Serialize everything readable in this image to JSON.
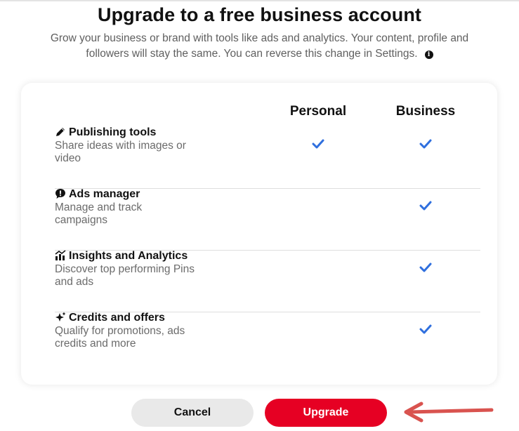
{
  "modal": {
    "title": "Upgrade to a free business account",
    "subtitle": "Grow your business or brand with tools like ads and analytics. Your content, profile and followers will stay the same. You can reverse this change in Settings.",
    "info_icon": "info-icon"
  },
  "comparison": {
    "columns": [
      "Personal",
      "Business"
    ],
    "rows": [
      {
        "icon": "pencil-icon",
        "title": "Publishing tools",
        "description": "Share ideas with images or video",
        "personal": true,
        "business": true
      },
      {
        "icon": "ads-speech-icon",
        "title": "Ads manager",
        "description": "Manage and track campaigns",
        "personal": false,
        "business": true
      },
      {
        "icon": "analytics-chart-icon",
        "title": "Insights and Analytics",
        "description": "Discover top performing Pins and ads",
        "personal": false,
        "business": true
      },
      {
        "icon": "sparkle-icon",
        "title": "Credits and offers",
        "description": "Qualify for promotions, ads credits and more",
        "personal": false,
        "business": true
      }
    ]
  },
  "actions": {
    "cancel_label": "Cancel",
    "upgrade_label": "Upgrade"
  },
  "colors": {
    "accent_red": "#e60023",
    "check_blue": "#2f6fde",
    "annotation_arrow": "#d9534f"
  }
}
